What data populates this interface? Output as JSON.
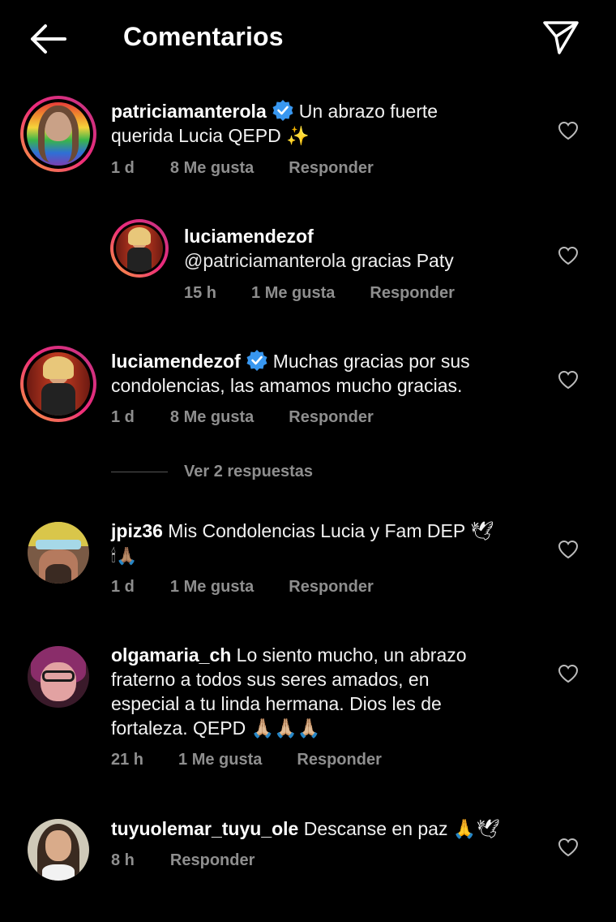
{
  "header": {
    "title": "Comentarios",
    "back_icon": "arrow-left-icon",
    "send_icon": "paper-plane-icon"
  },
  "comments": [
    {
      "username": "patriciamanterola",
      "verified": true,
      "text_line1": "Un abrazo fuerte",
      "text_line2": "querida Lucia QEPD ✨",
      "time": "1 d",
      "likes": "8 Me gusta",
      "reply": "Responder"
    },
    {
      "username": "luciamendezof",
      "mention": "@patriciamanterola",
      "text": " gracias Paty",
      "time": "15 h",
      "likes": "1 Me gusta",
      "reply": "Responder"
    },
    {
      "username": "luciamendezof",
      "verified": true,
      "text_line1": "Muchas gracias por sus",
      "text_line2": "condolencias, las amamos mucho  gracias.",
      "time": "1 d",
      "likes": "8 Me gusta",
      "reply": "Responder"
    },
    {
      "username": "jpiz36",
      "text_line1": " Mis Condolencias Lucia y Fam DEP 🕊",
      "text_line2": "🕯🙏🏽",
      "time": "1 d",
      "likes": "1 Me gusta",
      "reply": "Responder"
    },
    {
      "username": "olgamaria_ch",
      "text_line1": " Lo siento mucho, un abrazo",
      "text_line2": "fraterno a todos sus seres amados, en",
      "text_line3": "especial a tu linda hermana.  Dios les de",
      "text_line4": "fortaleza. QEPD 🙏🏼🙏🏼🙏🏼",
      "time": "21 h",
      "likes": "1 Me gusta",
      "reply": "Responder"
    },
    {
      "username": "tuyuolemar_tuyu_ole",
      "text": " Descanse en paz 🙏🕊",
      "time": "8 h",
      "reply": "Responder"
    }
  ],
  "view_replies": "Ver 2 respuestas",
  "colors": {
    "background": "#000000",
    "text": "#f2f2f2",
    "meta": "#8e8e8e",
    "verified": "#3897f0"
  }
}
